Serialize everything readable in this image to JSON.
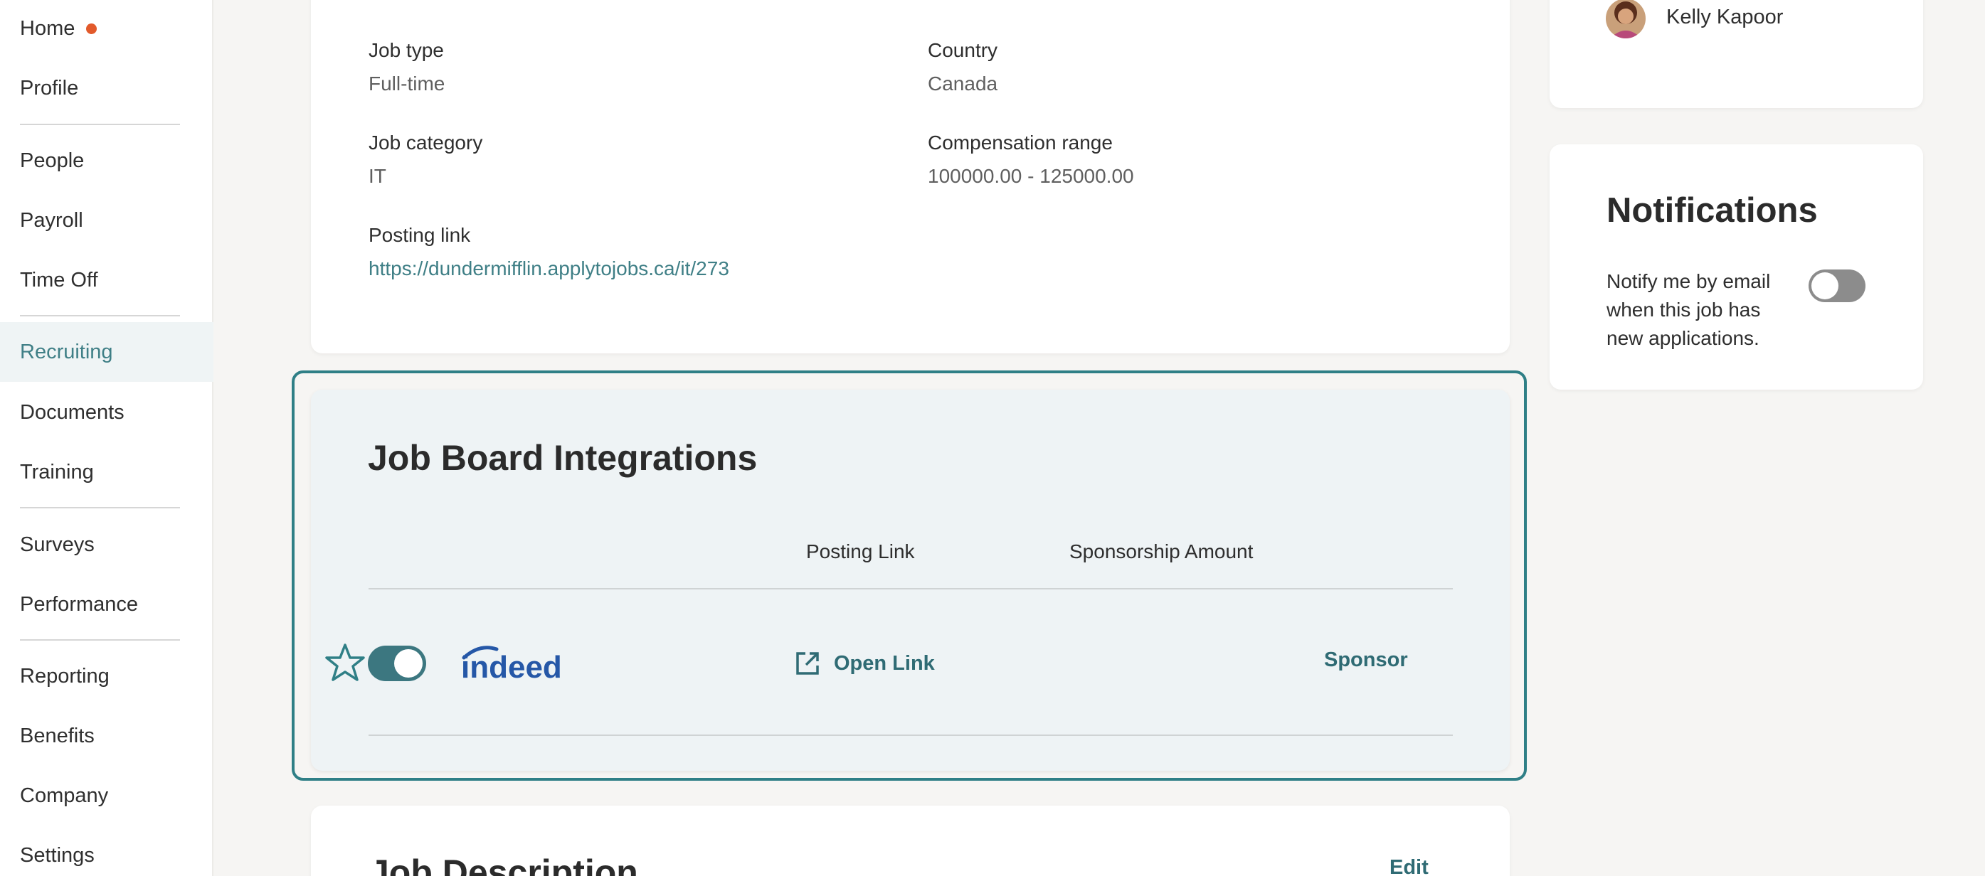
{
  "sidebar": {
    "items": [
      {
        "label": "Home"
      },
      {
        "label": "Profile"
      },
      {
        "label": "People"
      },
      {
        "label": "Payroll"
      },
      {
        "label": "Time Off"
      },
      {
        "label": "Recruiting"
      },
      {
        "label": "Documents"
      },
      {
        "label": "Training"
      },
      {
        "label": "Surveys"
      },
      {
        "label": "Performance"
      },
      {
        "label": "Reporting"
      },
      {
        "label": "Benefits"
      },
      {
        "label": "Company"
      },
      {
        "label": "Settings"
      }
    ],
    "active": "Recruiting"
  },
  "job_details": {
    "job_type": {
      "label": "Job type",
      "value": "Full-time"
    },
    "country": {
      "label": "Country",
      "value": "Canada"
    },
    "job_category": {
      "label": "Job category",
      "value": "IT"
    },
    "compensation": {
      "label": "Compensation range",
      "value": "100000.00 - 125000.00"
    },
    "posting_link": {
      "label": "Posting link",
      "value": "https://dundermifflin.applytojobs.ca/it/273"
    }
  },
  "integrations": {
    "title": "Job Board Integrations",
    "columns": {
      "posting_link": "Posting Link",
      "sponsorship": "Sponsorship Amount"
    },
    "rows": [
      {
        "board": "indeed",
        "enabled": true,
        "open_link_label": "Open Link",
        "sponsor_label": "Sponsor"
      }
    ]
  },
  "hiring_lead": {
    "name": "Kelly Kapoor"
  },
  "notifications": {
    "title": "Notifications",
    "text": "Notify me by email when this job has new applications.",
    "enabled": false
  },
  "description": {
    "title": "Job Description",
    "edit_label": "Edit"
  },
  "colors": {
    "accent": "#3f7f86",
    "home_dot": "#e25a2b",
    "indeed": "#2557a7"
  }
}
